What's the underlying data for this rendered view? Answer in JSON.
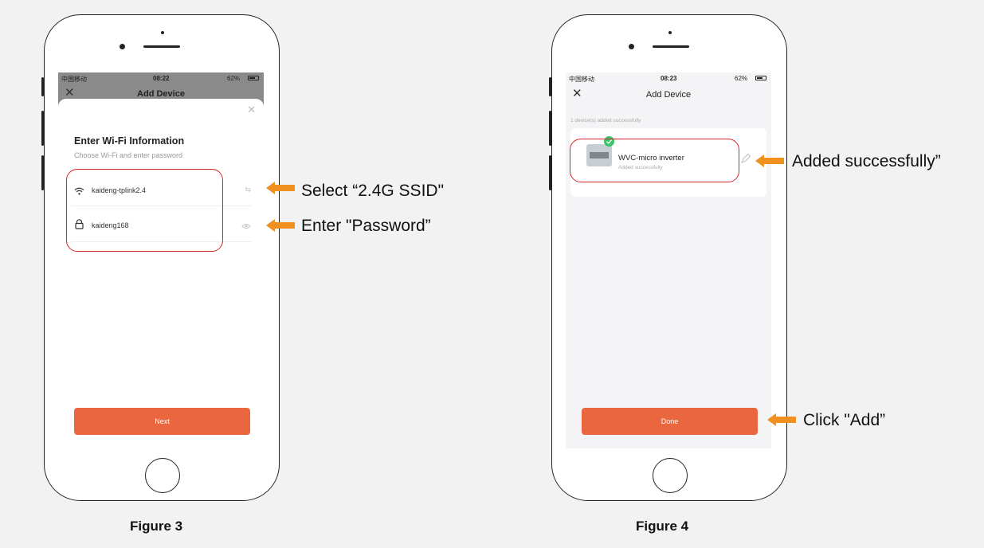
{
  "figure3": {
    "caption": "Figure 3",
    "status": {
      "carrier": "中国移动",
      "time": "08:22",
      "battery": "62%"
    },
    "nav_title": "Add Device",
    "sheet_title": "Enter Wi-Fi Information",
    "sheet_subtitle": "Choose Wi-Fi and enter password",
    "wifi_ssid": "kaideng-tplink2.4",
    "wifi_password": "kaideng168",
    "next_label": "Next",
    "annotation_ssid": "Select “2.4G SSID\"",
    "annotation_password": "Enter \"Password”"
  },
  "figure4": {
    "caption": "Figure 4",
    "status": {
      "carrier": "中国移动",
      "time": "08:23",
      "battery": "62%"
    },
    "nav_title": "Add Device",
    "summary": "1 device(s) added successfully",
    "device_name": "WVC-micro inverter",
    "device_status": "Added successfully",
    "done_label": "Done",
    "annotation_added": "Added successfully”",
    "annotation_click": "Click \"Add”"
  },
  "colors": {
    "accent": "#e9663f",
    "highlight": "#d6242b",
    "arrow": "#f0901e",
    "success": "#3cc46a"
  },
  "icons": [
    "close-icon",
    "wifi-icon",
    "lock-icon",
    "switch-icon",
    "eye-icon",
    "check-icon",
    "edit-icon",
    "arrow-left-icon"
  ]
}
